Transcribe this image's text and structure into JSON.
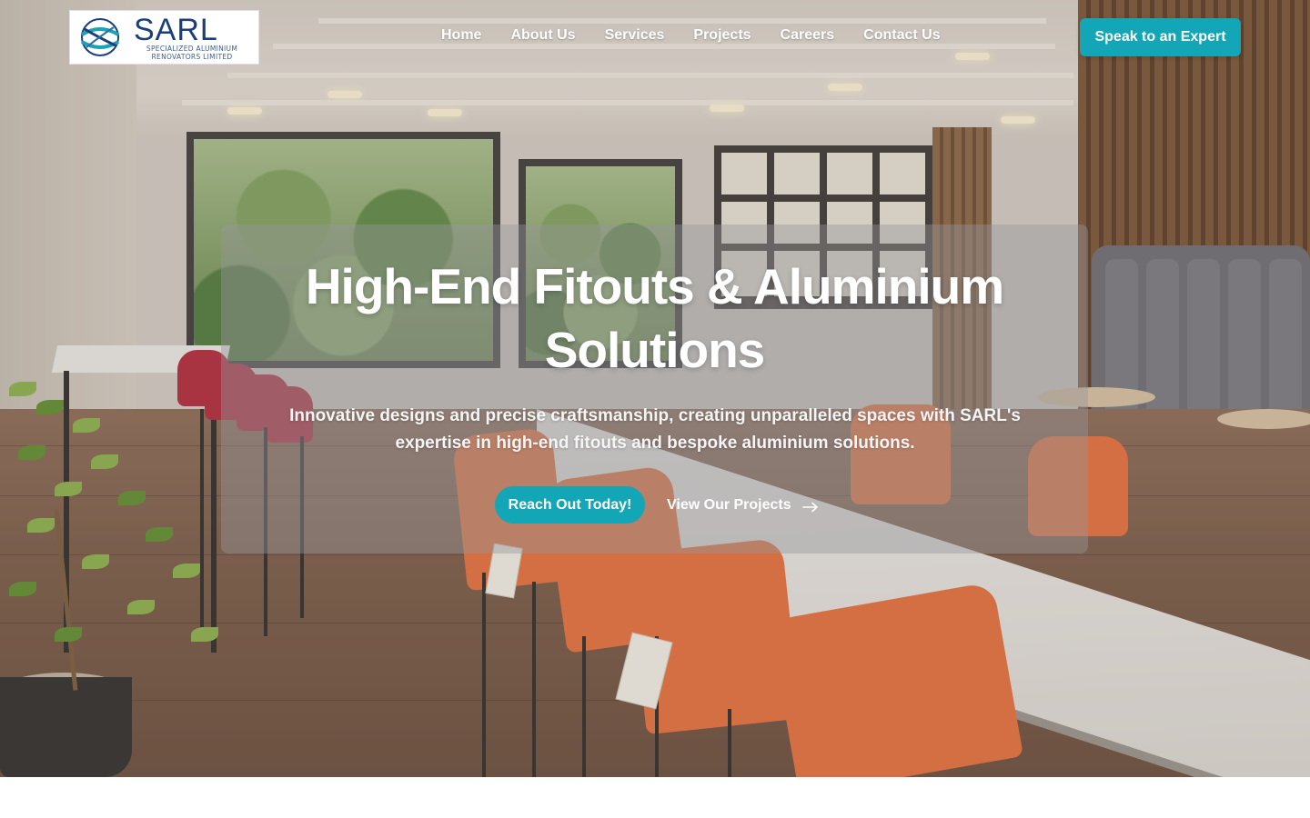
{
  "header": {
    "logo": {
      "main": "SARL",
      "sub": "SPECIALIZED ALUMINIUM RENOVATORS LIMITED",
      "icon": "globe-logo-icon"
    },
    "nav": [
      {
        "label": "Home"
      },
      {
        "label": "About Us"
      },
      {
        "label": "Services"
      },
      {
        "label": "Projects"
      },
      {
        "label": "Careers"
      },
      {
        "label": "Contact Us"
      }
    ],
    "cta_label": "Speak to an Expert"
  },
  "hero": {
    "title": "High-End Fitouts & Aluminium Solutions",
    "subtitle": "Innovative designs and precise craftsmanship, creating unparalleled spaces with SARL's expertise in high-end fitouts and bespoke aluminium solutions.",
    "primary_button": "Reach Out Today!",
    "secondary_button": "View Our Projects",
    "secondary_icon": "arrow-right-icon"
  },
  "colors": {
    "accent": "#12a6b6",
    "logo_blue": "#1b3f7a",
    "text_on_image": "#ffffff"
  }
}
